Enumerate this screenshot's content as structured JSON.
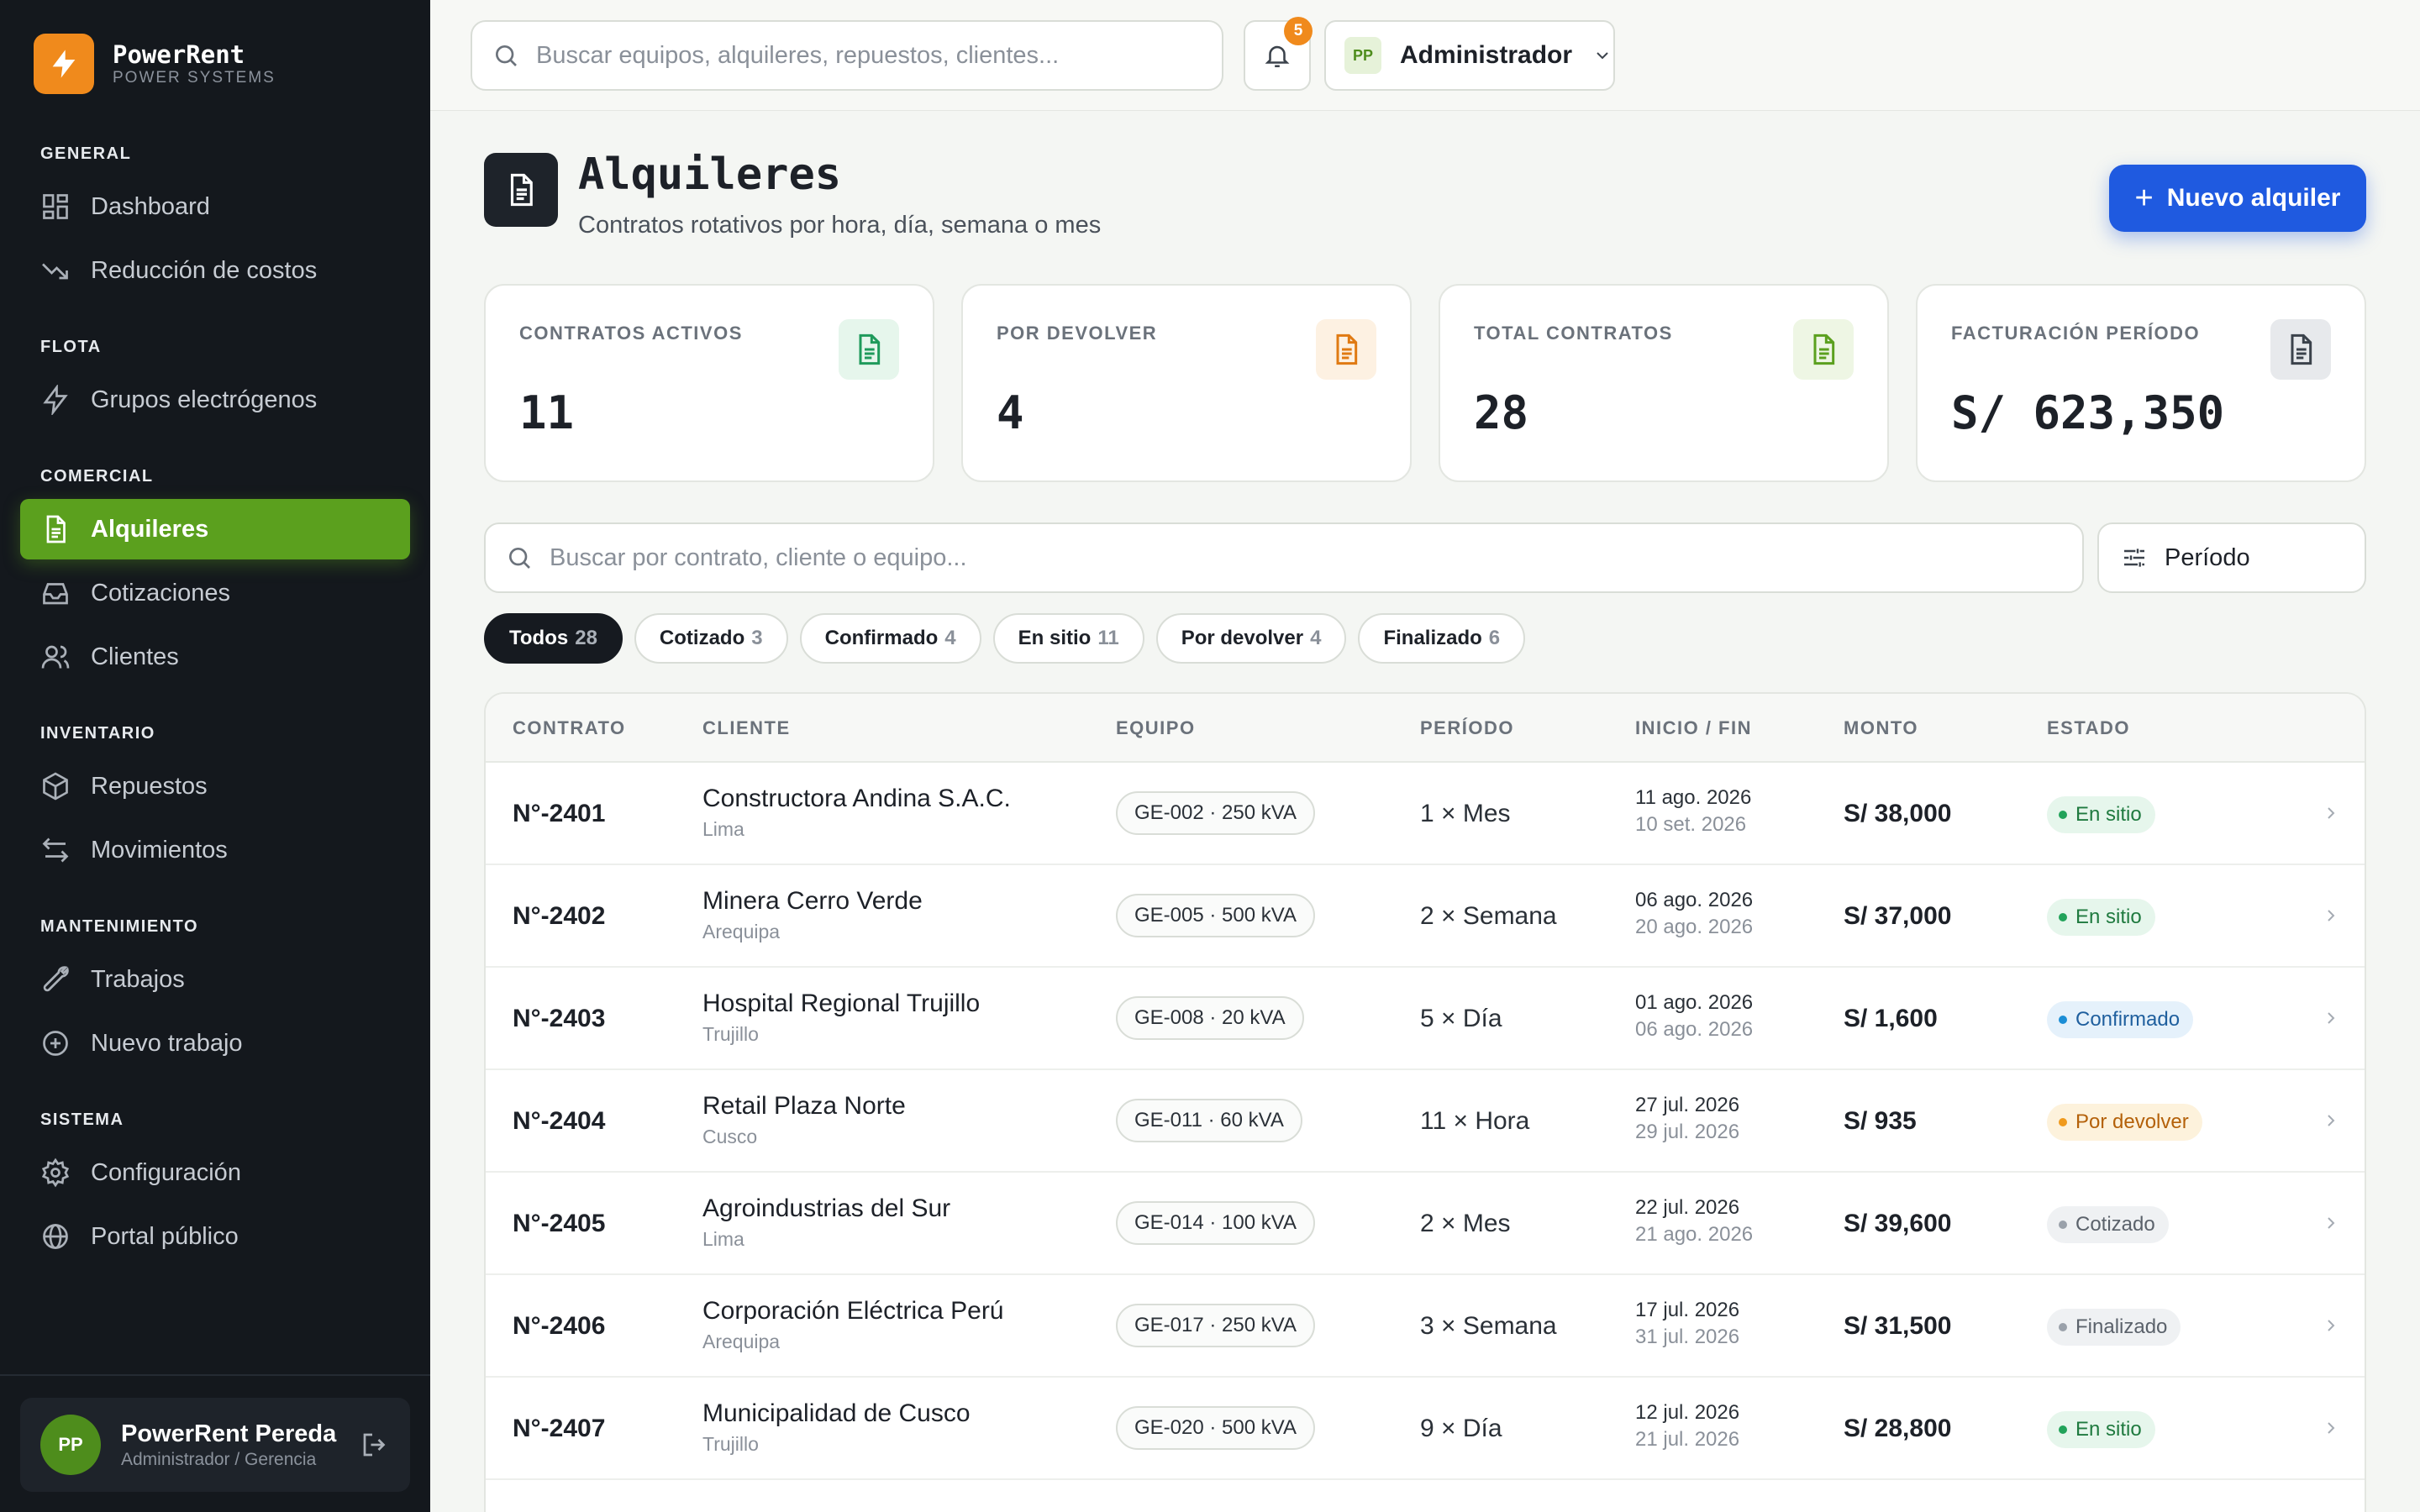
{
  "brand": {
    "name": "PowerRent",
    "subtitle": "POWER SYSTEMS"
  },
  "sidebar": {
    "sections": [
      {
        "title": "GENERAL"
      },
      {
        "title": "FLOTA"
      },
      {
        "title": "COMERCIAL"
      },
      {
        "title": "INVENTARIO"
      },
      {
        "title": "MANTENIMIENTO"
      },
      {
        "title": "SISTEMA"
      }
    ],
    "items": [
      {
        "label": "Dashboard",
        "icon": "grid-icon"
      },
      {
        "label": "Reducción de costos",
        "icon": "trend-down-icon"
      },
      {
        "label": "Grupos electrógenos",
        "icon": "bolt-icon"
      },
      {
        "label": "Alquileres",
        "icon": "document-icon",
        "active": true
      },
      {
        "label": "Cotizaciones",
        "icon": "inbox-icon"
      },
      {
        "label": "Clientes",
        "icon": "users-icon"
      },
      {
        "label": "Repuestos",
        "icon": "box-icon"
      },
      {
        "label": "Movimientos",
        "icon": "swap-icon"
      },
      {
        "label": "Trabajos",
        "icon": "wrench-icon"
      },
      {
        "label": "Nuevo trabajo",
        "icon": "plus-circle-icon"
      },
      {
        "label": "Configuración",
        "icon": "gear-icon"
      },
      {
        "label": "Portal público",
        "icon": "globe-icon"
      }
    ],
    "user": {
      "initials": "PP",
      "name": "PowerRent Pereda",
      "role": "Administrador / Gerencia"
    }
  },
  "topbar": {
    "search_placeholder": "Buscar equipos, alquileres, repuestos, clientes...",
    "notifications": "5",
    "admin": {
      "initials": "PP",
      "label": "Administrador"
    }
  },
  "page": {
    "title": "Alquileres",
    "subtitle": "Contratos rotativos por hora, día, semana o mes",
    "new_button": "Nuevo alquiler"
  },
  "kpis": [
    {
      "label": "CONTRATOS ACTIVOS",
      "value": "11",
      "color": "#1f9a5b",
      "bg": "#e6f6ec"
    },
    {
      "label": "POR DEVOLVER",
      "value": "4",
      "color": "#e07a12",
      "bg": "#fdf1e2"
    },
    {
      "label": "TOTAL CONTRATOS",
      "value": "28",
      "color": "#5ba01e",
      "bg": "#eef6e4"
    },
    {
      "label": "FACTURACIÓN PERÍODO",
      "value": "S/ 623,350",
      "color": "#3b424b",
      "bg": "#e7e9ec"
    }
  ],
  "filters": {
    "search_placeholder": "Buscar por contrato, cliente o equipo...",
    "period_label": "Período",
    "chips": [
      {
        "label": "Todos",
        "count": "28"
      },
      {
        "label": "Cotizado",
        "count": "3"
      },
      {
        "label": "Confirmado",
        "count": "4"
      },
      {
        "label": "En sitio",
        "count": "11"
      },
      {
        "label": "Por devolver",
        "count": "4"
      },
      {
        "label": "Finalizado",
        "count": "6"
      }
    ]
  },
  "table": {
    "headers": [
      "CONTRATO",
      "CLIENTE",
      "EQUIPO",
      "PERÍODO",
      "INICIO / FIN",
      "MONTO",
      "ESTADO"
    ],
    "rows": [
      {
        "contract": "N°-2401",
        "client": "Constructora Andina S.A.C.",
        "city": "Lima",
        "equipment": "GE-002 · 250 kVA",
        "period": "1 × Mes",
        "start": "11 ago. 2026",
        "end": "10 set. 2026",
        "amount": "S/ 38,000",
        "status": "En sitio"
      },
      {
        "contract": "N°-2402",
        "client": "Minera Cerro Verde",
        "city": "Arequipa",
        "equipment": "GE-005 · 500 kVA",
        "period": "2 × Semana",
        "start": "06 ago. 2026",
        "end": "20 ago. 2026",
        "amount": "S/ 37,000",
        "status": "En sitio"
      },
      {
        "contract": "N°-2403",
        "client": "Hospital Regional Trujillo",
        "city": "Trujillo",
        "equipment": "GE-008 · 20 kVA",
        "period": "5 × Día",
        "start": "01 ago. 2026",
        "end": "06 ago. 2026",
        "amount": "S/ 1,600",
        "status": "Confirmado"
      },
      {
        "contract": "N°-2404",
        "client": "Retail Plaza Norte",
        "city": "Cusco",
        "equipment": "GE-011 · 60 kVA",
        "period": "11 × Hora",
        "start": "27 jul. 2026",
        "end": "29 jul. 2026",
        "amount": "S/ 935",
        "status": "Por devolver"
      },
      {
        "contract": "N°-2405",
        "client": "Agroindustrias del Sur",
        "city": "Lima",
        "equipment": "GE-014 · 100 kVA",
        "period": "2 × Mes",
        "start": "22 jul. 2026",
        "end": "21 ago. 2026",
        "amount": "S/ 39,600",
        "status": "Cotizado"
      },
      {
        "contract": "N°-2406",
        "client": "Corporación Eléctrica Perú",
        "city": "Arequipa",
        "equipment": "GE-017 · 250 kVA",
        "period": "3 × Semana",
        "start": "17 jul. 2026",
        "end": "31 jul. 2026",
        "amount": "S/ 31,500",
        "status": "Finalizado"
      },
      {
        "contract": "N°-2407",
        "client": "Municipalidad de Cusco",
        "city": "Trujillo",
        "equipment": "GE-020 · 500 kVA",
        "period": "9 × Día",
        "start": "12 jul. 2026",
        "end": "21 jul. 2026",
        "amount": "S/ 28,800",
        "status": "En sitio"
      }
    ]
  }
}
